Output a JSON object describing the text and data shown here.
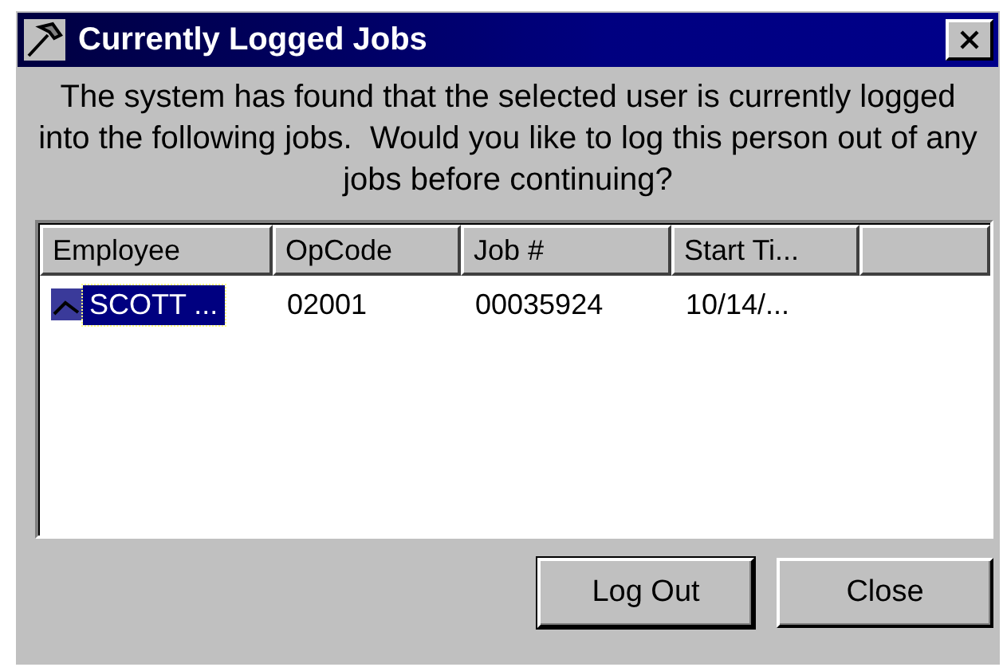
{
  "window": {
    "title": "Currently Logged Jobs"
  },
  "message": "The system has found that the selected user is currently logged into the following jobs.  Would you like to log this person out of any jobs before continuing?",
  "table": {
    "columns": [
      "Employee",
      "OpCode",
      "Job #",
      "Start Ti..."
    ],
    "rows": [
      {
        "cells": [
          "SCOTT ...",
          "02001",
          "00035924",
          "10/14/..."
        ],
        "selected": true
      }
    ]
  },
  "buttons": [
    {
      "label": "Log Out",
      "default": true
    },
    {
      "label": "Close",
      "default": false
    }
  ]
}
